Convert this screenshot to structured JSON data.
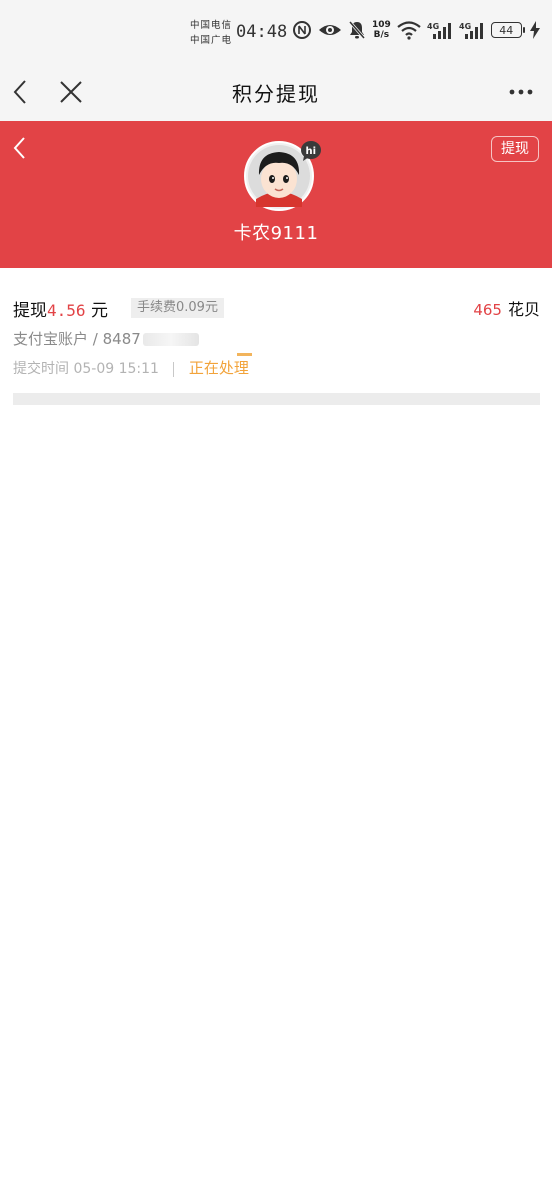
{
  "status_bar": {
    "carrier_1": "中国电信",
    "carrier_2": "中国广电",
    "time": "04:48",
    "net_speed_value": "109",
    "net_speed_unit": "B/s",
    "battery_level": "44",
    "icons": [
      "nfc-icon",
      "eye-icon",
      "bell-off-icon",
      "wifi-icon",
      "signal-4g-icon",
      "signal-4g-icon",
      "battery-icon",
      "charging-icon"
    ]
  },
  "navbar": {
    "title": "积分提现",
    "icons": [
      "back-arrow-icon",
      "close-icon",
      "more-icon"
    ]
  },
  "profile": {
    "username": "卡农9111",
    "withdraw_button": "提现",
    "badge": "hi",
    "background_color": "#e24346"
  },
  "record": {
    "title_prefix": "提现",
    "amount": "4.56",
    "unit": "元",
    "fee": "手续费0.09元",
    "points_value": "465",
    "points_unit": "花贝",
    "account_label": "支付宝账户",
    "account_partial": "/ 8487",
    "submit_label": "提交时间",
    "submit_time": "05-09 15:11",
    "status": "正在处理",
    "accent_color": "#e24346",
    "status_color": "#f2a33a"
  }
}
